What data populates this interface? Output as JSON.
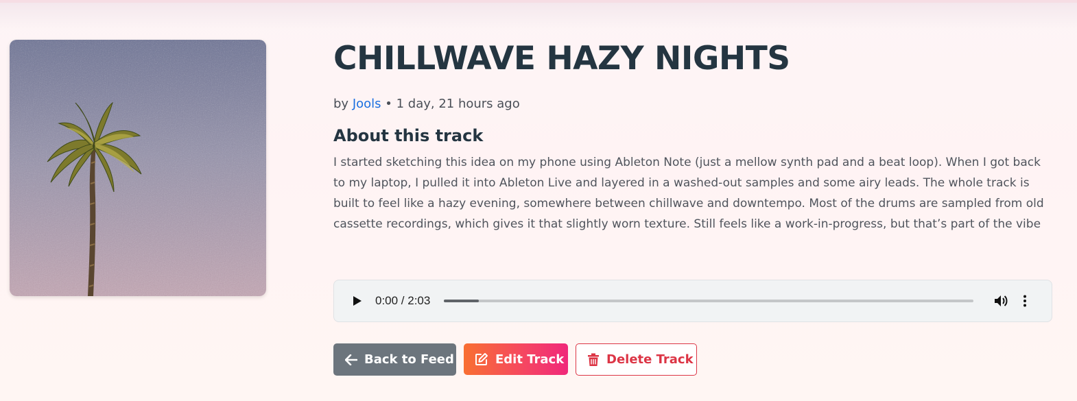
{
  "track": {
    "title": "CHILLWAVE HAZY NIGHTS",
    "by_prefix": "by ",
    "artist": "Jools",
    "separator": " • ",
    "posted": "1 day, 21 hours ago",
    "cover_alt": "Palm tree against a hazy purple sky"
  },
  "about": {
    "heading": "About this track",
    "description": "I started sketching this idea on my phone using Ableton Note (just a mellow synth pad and a beat loop). When I got back to my laptop, I pulled it into Ableton Live and layered in a washed-out samples and some airy leads. The whole track is built to feel like a hazy evening, somewhere between chillwave and downtempo. Most of the drums are sampled from old cassette recordings, which gives it that slightly worn texture. Still feels like a work-in-progress, but that’s part of the vibe"
  },
  "player": {
    "time_display": "0:00 / 2:03",
    "buffered_fraction": 0.066,
    "icons": {
      "play": "play-icon",
      "volume": "volume-icon",
      "more": "more-vert-icon"
    }
  },
  "actions": {
    "back_label": "Back to Feed",
    "edit_label": "Edit Track",
    "delete_label": "Delete Track",
    "icons": {
      "back": "arrow-left-icon",
      "edit": "edit-icon",
      "delete": "trash-icon"
    }
  },
  "colors": {
    "title": "#243541",
    "artist_link": "#1a6fe0",
    "back_button": "#6c757d",
    "edit_gradient_start": "#f86f32",
    "edit_gradient_end": "#f0287a",
    "delete": "#dc3545"
  }
}
